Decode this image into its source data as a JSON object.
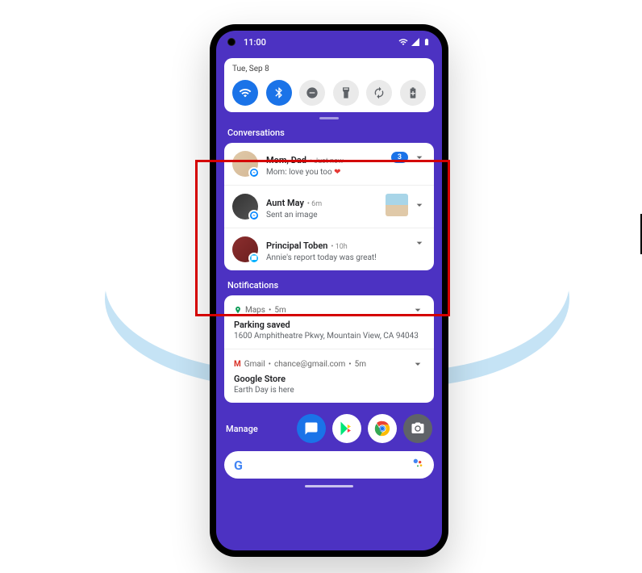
{
  "statusbar": {
    "time": "11:00"
  },
  "quick_settings": {
    "date": "Tue, Sep 8"
  },
  "conversations": {
    "header": "Conversations",
    "items": [
      {
        "title": "Mom, Dad",
        "time": "Just now",
        "msg": "Mom: love you too ",
        "count": "3"
      },
      {
        "title": "Aunt May",
        "time": "6m",
        "msg": "Sent an image"
      },
      {
        "title": "Principal Toben",
        "time": "10h",
        "msg": "Annie's report today was great!"
      }
    ]
  },
  "notifications": {
    "header": "Notifications",
    "items": [
      {
        "app": "Maps",
        "time": "5m",
        "title": "Parking saved",
        "body": "1600 Amphitheatre Pkwy, Mountain View, CA 94043"
      },
      {
        "app": "Gmail",
        "meta": "chance@gmail.com",
        "time": "5m",
        "title": "Google Store",
        "body": "Earth Day is here"
      }
    ]
  },
  "bottom": {
    "manage": "Manage"
  }
}
